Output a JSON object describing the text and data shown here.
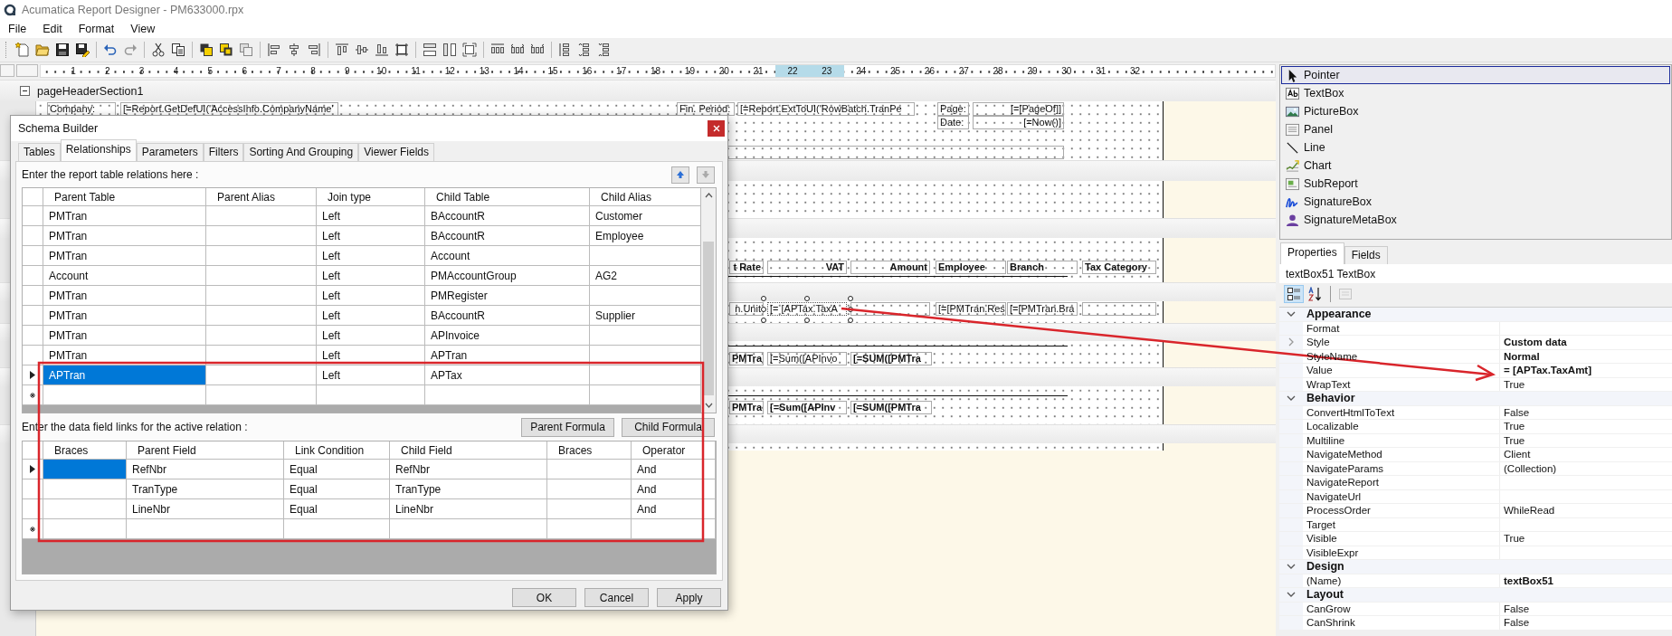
{
  "window": {
    "title": "Acumatica Report Designer - PM633000.rpx"
  },
  "menu": [
    "File",
    "Edit",
    "Format",
    "View"
  ],
  "ruler": [
    {
      "label": "1",
      "highlighted": false
    },
    {
      "label": "2",
      "highlighted": false
    },
    {
      "label": "3",
      "highlighted": false
    },
    {
      "label": "4",
      "highlighted": false
    },
    {
      "label": "5",
      "highlighted": false
    },
    {
      "label": "6",
      "highlighted": false
    },
    {
      "label": "7",
      "highlighted": false
    },
    {
      "label": "8",
      "highlighted": false
    },
    {
      "label": "9",
      "highlighted": false
    },
    {
      "label": "10",
      "highlighted": false
    },
    {
      "label": "11",
      "highlighted": false
    },
    {
      "label": "12",
      "highlighted": false
    },
    {
      "label": "13",
      "highlighted": false
    },
    {
      "label": "14",
      "highlighted": false
    },
    {
      "label": "15",
      "highlighted": false
    },
    {
      "label": "16",
      "highlighted": false
    },
    {
      "label": "17",
      "highlighted": false
    },
    {
      "label": "18",
      "highlighted": false
    },
    {
      "label": "19",
      "highlighted": false
    },
    {
      "label": "20",
      "highlighted": false
    },
    {
      "label": "21",
      "highlighted": false
    },
    {
      "label": "22",
      "highlighted": true
    },
    {
      "label": "23",
      "highlighted": true
    },
    {
      "label": "24",
      "highlighted": false
    },
    {
      "label": "25",
      "highlighted": false
    },
    {
      "label": "26",
      "highlighted": false
    },
    {
      "label": "27",
      "highlighted": false
    },
    {
      "label": "28",
      "highlighted": false
    },
    {
      "label": "29",
      "highlighted": false
    },
    {
      "label": "30",
      "highlighted": false
    },
    {
      "label": "31",
      "highlighted": false
    },
    {
      "label": "32",
      "highlighted": false
    }
  ],
  "designer": {
    "sections": [
      {
        "label": "pageHeaderSection1",
        "expanded": true,
        "items": [
          {
            "text": "Company:",
            "bold": false,
            "selected": false
          },
          {
            "text": "[=Report.GetDefUI('AccessInfo.CompanyName'",
            "bold": false,
            "selected": false
          },
          {
            "text": "Fin. Period:",
            "bold": false,
            "selected": false
          },
          {
            "text": "[=Report.ExtToUI('RowBatch.TranPe",
            "bold": false,
            "selected": false
          },
          {
            "text": "Page:",
            "bold": false,
            "selected": false
          },
          {
            "text": "[=[PageOf]]",
            "bold": false,
            "selected": false
          },
          {
            "text": "Date:",
            "bold": false,
            "selected": false
          },
          {
            "text": "[=Now()]",
            "bold": false,
            "selected": false
          }
        ]
      },
      {
        "items": [
          {
            "text": "t Rate",
            "bold": true,
            "selected": false
          },
          {
            "text": "VAT",
            "bold": true,
            "selected": false
          },
          {
            "text": "Amount",
            "bold": true,
            "selected": false
          },
          {
            "text": "Employee",
            "bold": true,
            "selected": false
          },
          {
            "text": "Branch",
            "bold": true,
            "selected": false
          },
          {
            "text": "Tax Category",
            "bold": true,
            "selected": false
          }
        ]
      },
      {
        "items": [
          {
            "text": "n.Unit",
            "bold": false,
            "selected": false
          },
          {
            "text": "[= [APTax.TaxA",
            "bold": false,
            "selected": true
          },
          {
            "text": "[=[PMTran.Res",
            "bold": false,
            "selected": false
          },
          {
            "text": "[=[PMTran.Bra",
            "bold": false,
            "selected": false
          }
        ]
      },
      {
        "items": [
          {
            "text": "PMTra",
            "bold": true,
            "selected": false
          },
          {
            "text": "[=Sum([APInvo",
            "bold": false,
            "selected": false
          },
          {
            "text": "[=SUM([PMTra",
            "bold": true,
            "selected": false
          }
        ]
      },
      {
        "items": [
          {
            "text": "PMTra",
            "bold": true,
            "selected": false
          },
          {
            "text": "[=Sum([APInv",
            "bold": true,
            "selected": false
          },
          {
            "text": "[=SUM([PMTra",
            "bold": true,
            "selected": false
          }
        ]
      }
    ]
  },
  "schema_builder": {
    "title": "Schema Builder",
    "tabs": [
      {
        "label": "Tables",
        "selected": false
      },
      {
        "label": "Relationships",
        "selected": true
      },
      {
        "label": "Parameters",
        "selected": false
      },
      {
        "label": "Filters",
        "selected": false
      },
      {
        "label": "Sorting And Grouping",
        "selected": false
      },
      {
        "label": "Viewer Fields",
        "selected": false
      }
    ],
    "relations_label": "Enter the report table relations here :",
    "move_buttons": [
      {
        "kind": "up",
        "disabled": false
      },
      {
        "kind": "down",
        "disabled": true
      }
    ],
    "relations": {
      "columns": [
        "Parent Table",
        "Parent Alias",
        "Join type",
        "Child Table",
        "Child Alias"
      ],
      "rows": [
        {
          "parent_table": "PMTran",
          "join_type": "Left",
          "child_table": "BAccountR",
          "child_alias": "Customer",
          "selected": false
        },
        {
          "parent_table": "PMTran",
          "join_type": "Left",
          "child_table": "BAccountR",
          "child_alias": "Employee",
          "selected": false
        },
        {
          "parent_table": "PMTran",
          "join_type": "Left",
          "child_table": "Account",
          "selected": false
        },
        {
          "parent_table": "Account",
          "join_type": "Left",
          "child_table": "PMAccountGroup",
          "child_alias": "AG2",
          "selected": false
        },
        {
          "parent_table": "PMTran",
          "join_type": "Left",
          "child_table": "PMRegister",
          "selected": false
        },
        {
          "parent_table": "PMTran",
          "join_type": "Left",
          "child_table": "BAccountR",
          "child_alias": "Supplier",
          "selected": false
        },
        {
          "parent_table": "PMTran",
          "join_type": "Left",
          "child_table": "APInvoice",
          "selected": false
        },
        {
          "parent_table": "PMTran",
          "join_type": "Left",
          "child_table": "APTran",
          "selected": false
        },
        {
          "parent_table": "APTran",
          "join_type": "Left",
          "child_table": "APTax",
          "selected": true
        }
      ]
    },
    "links_label": "Enter the data field links for the active relation :",
    "formula_buttons": [
      "Parent Formula",
      "Child Formula"
    ],
    "links": {
      "columns": [
        "Braces",
        "Parent Field",
        "Link Condition",
        "Child Field",
        "Braces",
        "Operator"
      ],
      "rows": [
        {
          "parent_field": "RefNbr",
          "condition": "Equal",
          "child_field": "RefNbr",
          "operator": "And",
          "selected": true
        },
        {
          "parent_field": "TranType",
          "condition": "Equal",
          "child_field": "TranType",
          "operator": "And",
          "selected": false
        },
        {
          "parent_field": "LineNbr",
          "condition": "Equal",
          "child_field": "LineNbr",
          "operator": "And",
          "selected": false
        }
      ]
    },
    "buttons": [
      "OK",
      "Cancel",
      "Apply"
    ]
  },
  "toolbox": [
    {
      "label": "Pointer",
      "kind": "pointer",
      "selected": true
    },
    {
      "label": "TextBox",
      "kind": "textbox",
      "selected": false
    },
    {
      "label": "PictureBox",
      "kind": "picturebox",
      "selected": false
    },
    {
      "label": "Panel",
      "kind": "panel",
      "selected": false
    },
    {
      "label": "Line",
      "kind": "line",
      "selected": false
    },
    {
      "label": "Chart",
      "kind": "chart",
      "selected": false
    },
    {
      "label": "SubReport",
      "kind": "subreport",
      "selected": false
    },
    {
      "label": "SignatureBox",
      "kind": "signature",
      "selected": false
    },
    {
      "label": "SignatureMetaBox",
      "kind": "person",
      "selected": false
    }
  ],
  "properties": {
    "tabs": [
      {
        "label": "Properties",
        "selected": true
      },
      {
        "label": "Fields",
        "selected": false
      }
    ],
    "object": "textBox51 TextBox",
    "view_buttons": [
      {
        "kind": "categorized",
        "selected": true,
        "disabled": false
      },
      {
        "kind": "alphabetical",
        "selected": false,
        "disabled": false
      },
      {
        "kind": "pages",
        "selected": false,
        "disabled": true
      }
    ],
    "categories": [
      {
        "name": "Appearance",
        "expanded": true,
        "rows": [
          {
            "name": "Format",
            "expandable": false
          },
          {
            "name": "Style",
            "value": "Custom data",
            "expandable": true,
            "modified": true
          },
          {
            "name": "StyleName",
            "value": "Normal",
            "expandable": false,
            "modified": true
          },
          {
            "name": "Value",
            "value": "= [APTax.TaxAmt]",
            "expandable": false,
            "modified": true
          },
          {
            "name": "WrapText",
            "value": "True",
            "expandable": false,
            "modified": false
          }
        ]
      },
      {
        "name": "Behavior",
        "expanded": true,
        "rows": [
          {
            "name": "ConvertHtmlToText",
            "value": "False",
            "expandable": false,
            "modified": false
          },
          {
            "name": "Localizable",
            "value": "True",
            "expandable": false,
            "modified": false
          },
          {
            "name": "Multiline",
            "value": "True",
            "expandable": false,
            "modified": false
          },
          {
            "name": "NavigateMethod",
            "value": "Client",
            "expandable": false,
            "modified": false
          },
          {
            "name": "NavigateParams",
            "value": "(Collection)",
            "expandable": false,
            "modified": false
          },
          {
            "name": "NavigateReport",
            "expandable": false
          },
          {
            "name": "NavigateUrl",
            "expandable": false
          },
          {
            "name": "ProcessOrder",
            "value": "WhileRead",
            "expandable": false,
            "modified": false
          },
          {
            "name": "Target",
            "expandable": false
          },
          {
            "name": "Visible",
            "value": "True",
            "expandable": false,
            "modified": false
          },
          {
            "name": "VisibleExpr",
            "expandable": false
          }
        ]
      },
      {
        "name": "Design",
        "expanded": true,
        "rows": [
          {
            "name": "(Name)",
            "value": "textBox51",
            "expandable": false,
            "modified": true
          }
        ]
      },
      {
        "name": "Layout",
        "expanded": true,
        "rows": [
          {
            "name": "CanGrow",
            "value": "False",
            "expandable": false,
            "modified": false
          },
          {
            "name": "CanShrink",
            "value": "False",
            "expandable": false,
            "modified": false
          }
        ]
      }
    ]
  }
}
